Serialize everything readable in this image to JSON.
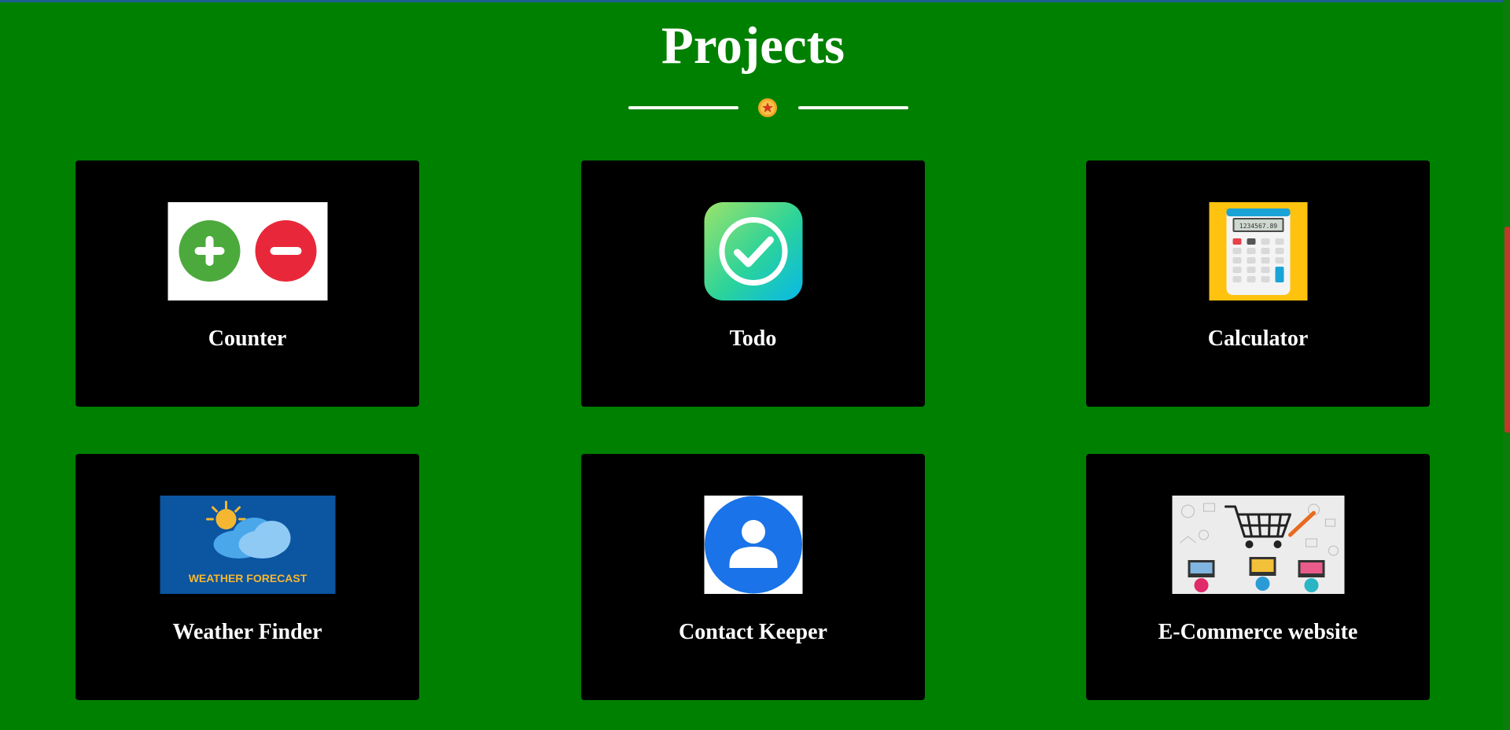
{
  "section": {
    "title": "Projects"
  },
  "colors": {
    "background": "#008000",
    "card": "#000000",
    "text": "#ffffff",
    "badge": "#f5a623"
  },
  "projects": [
    {
      "label": "Counter",
      "icon": "plus-minus-icon"
    },
    {
      "label": "Todo",
      "icon": "checkmark-icon"
    },
    {
      "label": "Calculator",
      "icon": "calculator-icon"
    },
    {
      "label": "Weather Finder",
      "icon": "weather-icon",
      "image_text": "WEATHER FORECAST"
    },
    {
      "label": "Contact Keeper",
      "icon": "contact-person-icon"
    },
    {
      "label": "E-Commerce website",
      "icon": "shopping-cart-icon"
    }
  ],
  "calculator_display": "1234567.89"
}
